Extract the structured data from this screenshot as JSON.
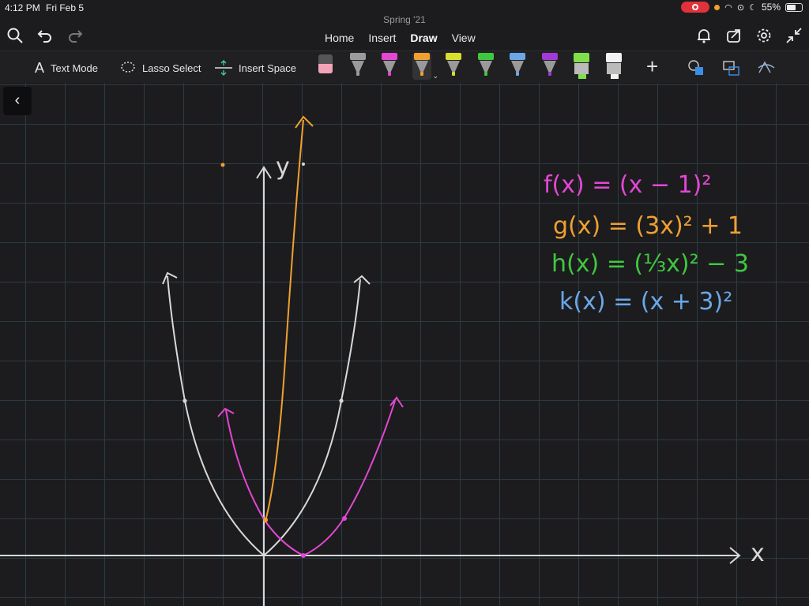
{
  "status": {
    "time": "4:12 PM",
    "date": "Fri Feb 5",
    "battery": "55%"
  },
  "document": {
    "title": "Spring '21"
  },
  "nav": {
    "tabs": [
      {
        "label": "Home"
      },
      {
        "label": "Insert"
      },
      {
        "label": "Draw"
      },
      {
        "label": "View"
      }
    ],
    "active_tab": "Draw"
  },
  "ribbon": {
    "text_mode": "Text Mode",
    "lasso_select": "Lasso Select",
    "insert_space": "Insert Space"
  },
  "pens": [
    {
      "name": "eraser",
      "color": "#f2a3b8"
    },
    {
      "name": "gray-pen",
      "color": "#9b9b9b"
    },
    {
      "name": "magenta-pen",
      "color": "#e447d4"
    },
    {
      "name": "orange-pen",
      "color": "#f0a030",
      "selected": true
    },
    {
      "name": "yellow-pen",
      "color": "#d9df2c"
    },
    {
      "name": "green-pen",
      "color": "#3fc83f"
    },
    {
      "name": "blue-pen",
      "color": "#6aa8e8"
    },
    {
      "name": "purple-pen",
      "color": "#a23ad6"
    },
    {
      "name": "green-highlighter",
      "color": "#7fe04a"
    },
    {
      "name": "white-highlighter",
      "color": "#f2f2f2"
    }
  ],
  "equations": [
    {
      "text": "f(x) = (x − 1)²",
      "color": "#e447d4"
    },
    {
      "text": "g(x) = (3x)² + 1",
      "color": "#f0a030"
    },
    {
      "text": "h(x) = (⅓x)² − 3",
      "color": "#3fc83f"
    },
    {
      "text": "k(x) = (x + 3)²",
      "color": "#6aa8e8"
    }
  ],
  "axes": {
    "x_label": "x",
    "y_label": "y"
  },
  "colors": {
    "white_curve": "#d8d8d8",
    "magenta_curve": "#e447d4",
    "orange_curve": "#f0a030",
    "grid": "#2d3a44"
  }
}
